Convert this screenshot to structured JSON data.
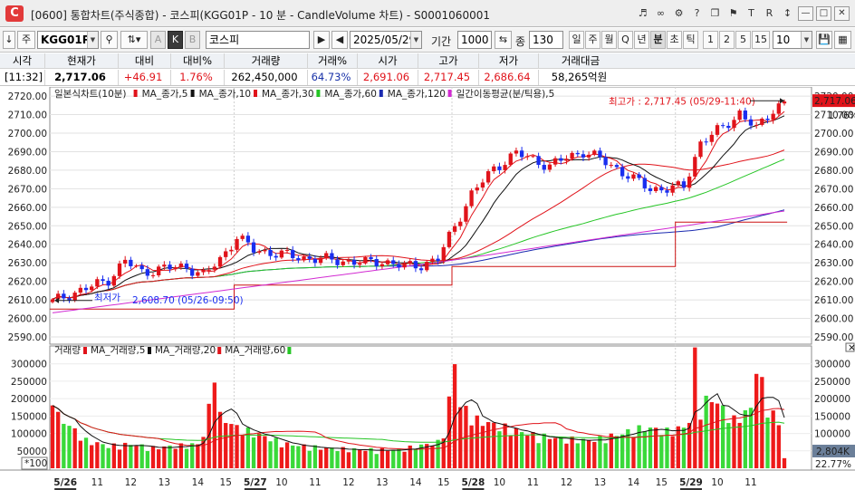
{
  "window": {
    "logo": "C",
    "title": "[0600] 통합차트(주식종합) - 코스피(KGG01P - 10 분 - CandleVolume 차트) - S0001060001"
  },
  "toolbar": {
    "code": "KGG01P",
    "name": "코스피",
    "date": "2025/05/29",
    "period_label": "기간",
    "period_value": "1000",
    "count_label": "종",
    "count_value": "130",
    "interval_value": "10",
    "type_a": "A",
    "type_k": "K",
    "type_b": "B",
    "stock_toggle": "주",
    "periods": [
      "일",
      "주",
      "월",
      "Q",
      "년",
      "분",
      "초",
      "틱",
      "1",
      "2",
      "5",
      "15"
    ],
    "active_period": "분"
  },
  "quote": {
    "headers": [
      "시각",
      "현재가",
      "대비",
      "대비%",
      "거래량",
      "거래%",
      "시가",
      "고가",
      "저가",
      "거래대금"
    ],
    "values": [
      "[11:32]",
      "2,717.06",
      "+46.91",
      "1.76%",
      "262,450,000",
      "64.73%",
      "2,691.06",
      "2,717.45",
      "2,686.64",
      "58,265억원"
    ]
  },
  "price_panel": {
    "legend": [
      {
        "label": "일본식차트(10분)",
        "color": "#222222"
      },
      {
        "label": "MA_종가,5",
        "color": "#222222"
      },
      {
        "label": "MA_종가,10",
        "color": "#222222"
      },
      {
        "label": "MA_종가,30",
        "color": "#222222"
      },
      {
        "label": "MA_종가,60",
        "color": "#222222"
      },
      {
        "label": "MA_종가,120",
        "color": "#222222"
      },
      {
        "label": "일간이동평균(분/틱용),5",
        "color": "#222222"
      }
    ],
    "legend_marker_colors": [
      "#e0131a",
      "#111111",
      "#e0131a",
      "#25c525",
      "#1a2ab0",
      "#d22bd2"
    ],
    "y_ticks": [
      2590,
      2600,
      2610,
      2620,
      2630,
      2640,
      2650,
      2660,
      2670,
      2680,
      2690,
      2700,
      2710,
      2720
    ],
    "current_price_label": "2,717.06",
    "current_change_label": "1.76%",
    "high_annotation": "최고가 : 2,717.45 (05/29-11:40)",
    "low_annotation_prefix": "최저가",
    "low_annotation": "2,608.70 (05/26-09:50)"
  },
  "volume_panel": {
    "legend": [
      {
        "label": "거래량"
      },
      {
        "label": "MA_거래량,5"
      },
      {
        "label": "MA_거래량,20"
      },
      {
        "label": "MA_거래량,60"
      }
    ],
    "y_ticks": [
      "300000",
      "250000",
      "200000",
      "150000",
      "100000",
      "50000"
    ],
    "unit_label": "*100",
    "current_volume_label": "2,804K",
    "current_volume_pct": "22.77%"
  },
  "x_axis": {
    "labels": [
      {
        "text": "5/26",
        "bold": true
      },
      {
        "text": "11"
      },
      {
        "text": "12"
      },
      {
        "text": "13"
      },
      {
        "text": "14"
      },
      {
        "text": "15"
      },
      {
        "text": "5/27",
        "bold": true
      },
      {
        "text": "10"
      },
      {
        "text": "11"
      },
      {
        "text": "12"
      },
      {
        "text": "13"
      },
      {
        "text": "14"
      },
      {
        "text": "15"
      },
      {
        "text": "5/28",
        "bold": true
      },
      {
        "text": "10"
      },
      {
        "text": "11"
      },
      {
        "text": "12"
      },
      {
        "text": "13"
      },
      {
        "text": "14"
      },
      {
        "text": "15"
      },
      {
        "text": "5/29",
        "bold": true
      },
      {
        "text": "10"
      },
      {
        "text": "11"
      }
    ]
  },
  "chart_data": {
    "type": "candlestick",
    "interval": "10 min",
    "ylim": [
      2590,
      2722
    ],
    "anchors": [
      [
        0,
        2609
      ],
      [
        3,
        2613
      ],
      [
        6,
        2616
      ],
      [
        10,
        2621
      ],
      [
        13,
        2631
      ],
      [
        16,
        2625
      ],
      [
        20,
        2627
      ],
      [
        24,
        2628
      ],
      [
        27,
        2623
      ],
      [
        30,
        2632
      ],
      [
        33,
        2644
      ],
      [
        36,
        2637
      ],
      [
        40,
        2635
      ],
      [
        44,
        2633
      ],
      [
        48,
        2632
      ],
      [
        52,
        2631
      ],
      [
        56,
        2630
      ],
      [
        59,
        2631
      ],
      [
        63,
        2628
      ],
      [
        66,
        2629
      ],
      [
        69,
        2632
      ],
      [
        72,
        2650
      ],
      [
        75,
        2667
      ],
      [
        79,
        2681
      ],
      [
        83,
        2689
      ],
      [
        86,
        2686
      ],
      [
        89,
        2682
      ],
      [
        92,
        2687
      ],
      [
        95,
        2690
      ],
      [
        98,
        2686
      ],
      [
        101,
        2681
      ],
      [
        104,
        2675
      ],
      [
        107,
        2670
      ],
      [
        110,
        2670
      ],
      [
        113,
        2671
      ],
      [
        116,
        2695
      ],
      [
        120,
        2703
      ],
      [
        123,
        2711
      ],
      [
        126,
        2702
      ],
      [
        129,
        2713
      ],
      [
        131,
        2717.06
      ]
    ],
    "volume_anchors": [
      [
        0,
        220000
      ],
      [
        1,
        140000
      ],
      [
        3,
        115000
      ],
      [
        6,
        75000
      ],
      [
        10,
        60000
      ],
      [
        14,
        65000
      ],
      [
        18,
        55000
      ],
      [
        22,
        60000
      ],
      [
        26,
        65000
      ],
      [
        27,
        90000
      ],
      [
        28,
        160000
      ],
      [
        29,
        300000
      ],
      [
        30,
        140000
      ],
      [
        33,
        110000
      ],
      [
        37,
        90000
      ],
      [
        42,
        65000
      ],
      [
        48,
        55000
      ],
      [
        55,
        50000
      ],
      [
        62,
        50000
      ],
      [
        69,
        70000
      ],
      [
        70,
        100000
      ],
      [
        71,
        180000
      ],
      [
        72,
        290000
      ],
      [
        73,
        170000
      ],
      [
        76,
        130000
      ],
      [
        81,
        110000
      ],
      [
        86,
        90000
      ],
      [
        91,
        80000
      ],
      [
        96,
        75000
      ],
      [
        101,
        90000
      ],
      [
        106,
        110000
      ],
      [
        110,
        100000
      ],
      [
        113,
        110000
      ],
      [
        114,
        130000
      ],
      [
        115,
        300000
      ],
      [
        116,
        170000
      ],
      [
        118,
        190000
      ],
      [
        122,
        130000
      ],
      [
        125,
        160000
      ],
      [
        126,
        280000
      ],
      [
        128,
        170000
      ],
      [
        130,
        120000
      ],
      [
        131,
        28040
      ]
    ],
    "daily_ma5": [
      {
        "day": "5/26",
        "value": 2605
      },
      {
        "day": "5/27",
        "value": 2618
      },
      {
        "day": "5/28",
        "value": 2628
      },
      {
        "day": "5/29",
        "value": 2652
      }
    ],
    "high": {
      "value": 2717.45,
      "time": "05/29-11:40"
    },
    "low": {
      "value": 2608.7,
      "time": "05/26-09:50"
    }
  }
}
